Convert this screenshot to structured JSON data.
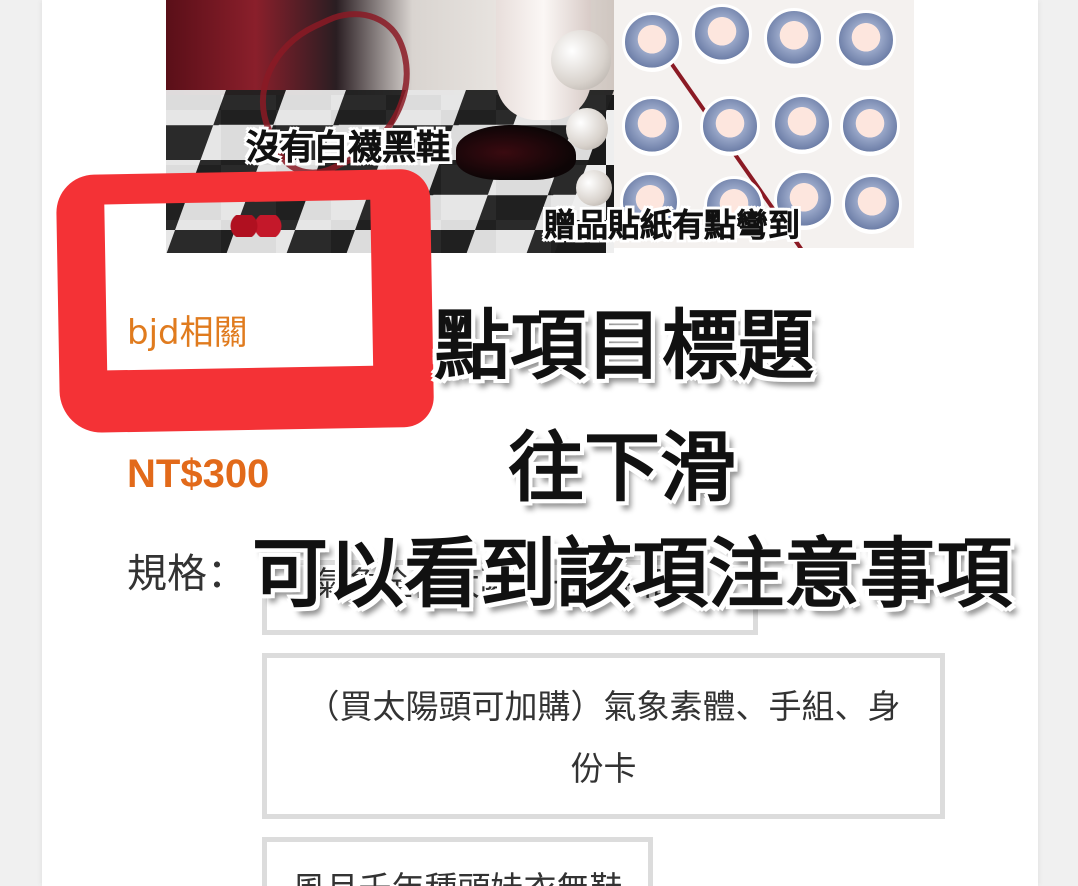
{
  "product": {
    "photo_caption_left": "沒有白襪黑鞋",
    "photo_caption_right": "贈品貼紙有點彎到",
    "category": "bjd相關",
    "price": "NT$300",
    "spec_label": "規格：",
    "options": [
      {
        "label": "氣象全器太陽頭一般+相框"
      },
      {
        "label": "（買太陽頭可加購）氣象素體、手組、身份卡"
      },
      {
        "label": "風月千年種頭娃衣無鞋"
      }
    ]
  },
  "annotation": {
    "line1": "點項目標題",
    "line2": "往下滑",
    "line3": "可以看到該項注意事項",
    "highlight_color": "#f43236"
  },
  "colors": {
    "accent_orange": "#e26a1a",
    "category_orange": "#e07b1e",
    "option_border": "#dcdcdc"
  }
}
